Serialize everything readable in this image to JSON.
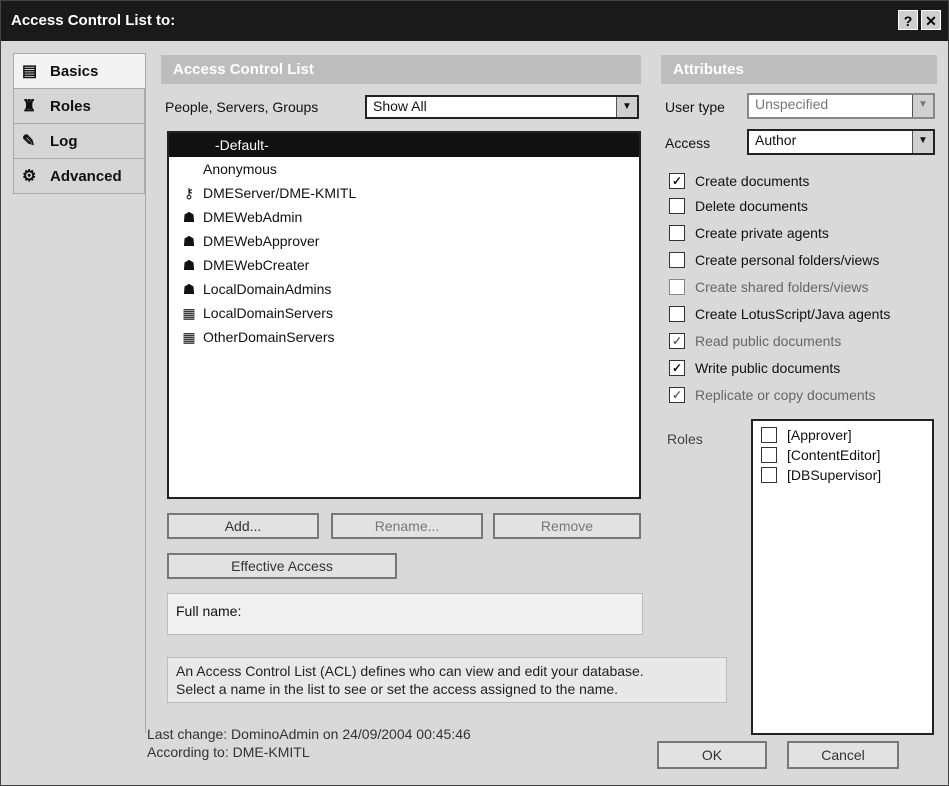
{
  "window": {
    "title": "Access Control List to:",
    "help_label": "?",
    "close_label": "✕"
  },
  "nav": [
    {
      "label": "Basics",
      "icon": "basics-icon"
    },
    {
      "label": "Roles",
      "icon": "roles-icon"
    },
    {
      "label": "Log",
      "icon": "log-icon"
    },
    {
      "label": "Advanced",
      "icon": "advanced-icon"
    }
  ],
  "acl": {
    "header": "Access Control List",
    "filter_label": "People, Servers, Groups",
    "filter_value": "Show All",
    "entries": [
      {
        "name": "-Default-",
        "icon": ""
      },
      {
        "name": "Anonymous",
        "icon": ""
      },
      {
        "name": "DMEServer/DME-KMITL",
        "icon": "server-key-icon"
      },
      {
        "name": "DMEWebAdmin",
        "icon": "group-icon"
      },
      {
        "name": "DMEWebApprover",
        "icon": "group-icon"
      },
      {
        "name": "DMEWebCreater",
        "icon": "group-icon"
      },
      {
        "name": "LocalDomainAdmins",
        "icon": "group-icon"
      },
      {
        "name": "LocalDomainServers",
        "icon": "server-group-icon"
      },
      {
        "name": "OtherDomainServers",
        "icon": "server-group-icon"
      }
    ],
    "add_label": "Add...",
    "rename_label": "Rename...",
    "remove_label": "Remove",
    "effective_access_label": "Effective Access",
    "full_name_label": "Full name:",
    "info_text_1": "An Access Control List (ACL) defines who can view and edit your database.",
    "info_text_2": "Select a name in the list to see or set the access assigned to the name."
  },
  "attributes": {
    "header": "Attributes",
    "user_type_label": "User type",
    "user_type_value": "Unspecified",
    "access_label": "Access",
    "access_value": "Author",
    "options": [
      {
        "label": "Create documents",
        "checked": true,
        "enabled": true
      },
      {
        "label": "Delete documents",
        "checked": false,
        "enabled": true
      },
      {
        "label": "Create private agents",
        "checked": false,
        "enabled": true
      },
      {
        "label": "Create personal folders/views",
        "checked": false,
        "enabled": true
      },
      {
        "label": "Create shared folders/views",
        "checked": false,
        "enabled": false
      },
      {
        "label": "Create LotusScript/Java agents",
        "checked": false,
        "enabled": true
      },
      {
        "label": "Read public documents",
        "checked": true,
        "enabled": false
      },
      {
        "label": "Write public documents",
        "checked": true,
        "enabled": true
      },
      {
        "label": "Replicate or copy documents",
        "checked": true,
        "enabled": false
      }
    ],
    "roles_label": "Roles",
    "roles": [
      "[Approver]",
      "[ContentEditor]",
      "[DBSupervisor]"
    ]
  },
  "footer": {
    "last_change": "Last change: DominoAdmin on 24/09/2004 00:45:46",
    "according_to": "According to: DME-KMITL",
    "ok_label": "OK",
    "cancel_label": "Cancel"
  }
}
